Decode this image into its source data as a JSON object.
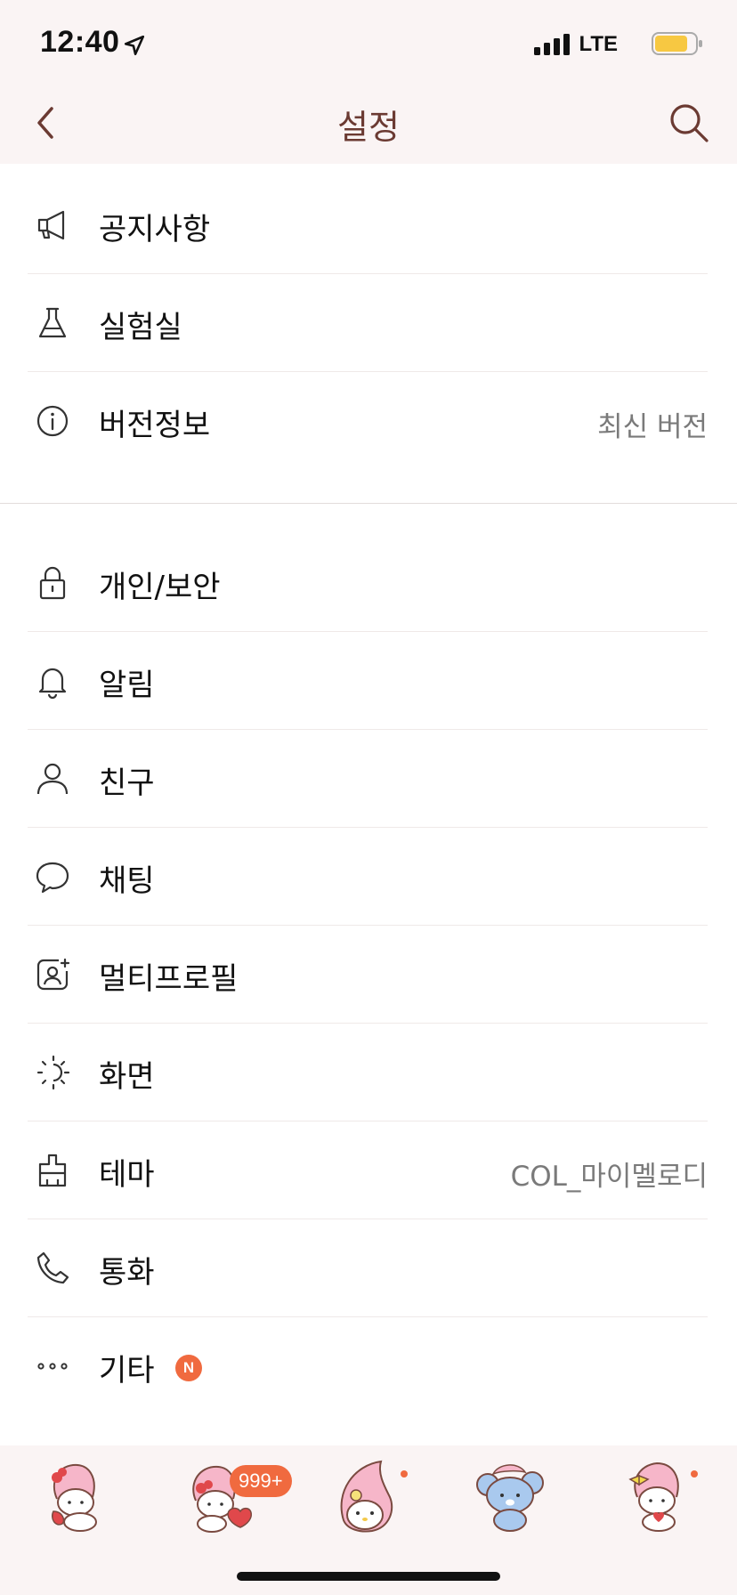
{
  "status_bar": {
    "time": "12:40",
    "network": "LTE",
    "location_icon": "location-arrow-icon",
    "signal_icon": "cellular-signal-icon",
    "battery_icon": "battery-icon",
    "battery_color": "#f7c842"
  },
  "header": {
    "title": "설정",
    "back_icon": "chevron-left-icon",
    "search_icon": "search-icon",
    "accent_color": "#6b3a32"
  },
  "section1": [
    {
      "label": "공지사항",
      "icon": "megaphone-icon"
    },
    {
      "label": "실험실",
      "icon": "flask-icon"
    },
    {
      "label": "버전정보",
      "icon": "info-icon",
      "value": "최신 버전"
    }
  ],
  "section2": [
    {
      "label": "개인/보안",
      "icon": "lock-icon"
    },
    {
      "label": "알림",
      "icon": "bell-icon"
    },
    {
      "label": "친구",
      "icon": "person-icon"
    },
    {
      "label": "채팅",
      "icon": "chat-bubble-icon"
    },
    {
      "label": "멀티프로필",
      "icon": "multi-profile-icon"
    },
    {
      "label": "화면",
      "icon": "brightness-icon"
    },
    {
      "label": "테마",
      "icon": "theme-brush-icon",
      "value": "COL_마이멜로디"
    },
    {
      "label": "통화",
      "icon": "phone-icon"
    },
    {
      "label": "기타",
      "icon": "more-dots-icon",
      "badge": "N"
    }
  ],
  "tabbar": {
    "tabs": [
      {
        "icon": "friends-tab-icon"
      },
      {
        "icon": "chats-tab-icon",
        "badge": "999+"
      },
      {
        "icon": "view-tab-icon",
        "dot": true
      },
      {
        "icon": "shopping-tab-icon"
      },
      {
        "icon": "more-tab-icon",
        "dot": true
      }
    ],
    "badge_color": "#f06a3f"
  }
}
